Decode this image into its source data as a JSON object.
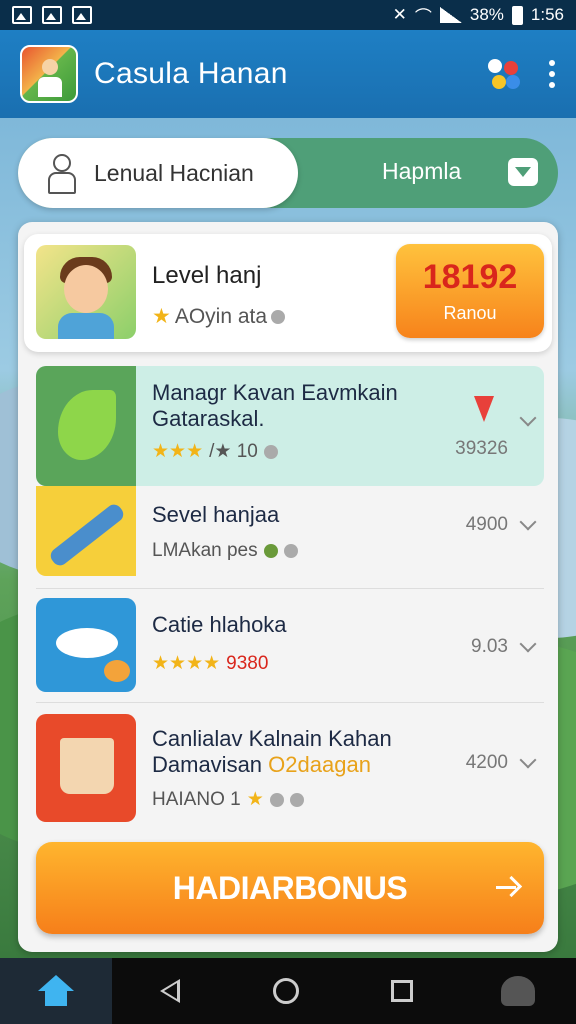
{
  "status_bar": {
    "battery": "38%",
    "time": "1:56"
  },
  "app_bar": {
    "title": "Casula Hanan",
    "icons": [
      "app-logo-icon",
      "cast-icon",
      "more-vert-icon"
    ]
  },
  "tabs": {
    "left_label": "Lenual Hacnian",
    "right_label": "Hapmla"
  },
  "profile": {
    "name": "Level hanj",
    "subtitle": "AOyin ata",
    "score": "18192",
    "score_label": "Ranou"
  },
  "items": [
    {
      "title_line1": "Managr Kavan Eavmkain",
      "title_line2": "Gataraskal.",
      "meta": "/★ 10",
      "value": "39326"
    },
    {
      "title_line1": "Sevel hanjaa",
      "title_line2": "",
      "meta": "LMAkan pes",
      "value": "4900"
    },
    {
      "title_line1": "Catie hlahoka",
      "title_line2": "",
      "meta": "9380",
      "value": "9.03"
    },
    {
      "title_line1": "Canlialav Kalnain Kahan",
      "title_line2": "Damavisan",
      "title_line2_highlight": "O2daagan",
      "meta": "HAIANO 1",
      "value": "4200"
    }
  ],
  "bonus_button": {
    "label": "HADIARBONUS"
  },
  "colors": {
    "accent": "#1e7fc4",
    "orange": "#f7831b",
    "score_red": "#d9261c",
    "highlight_teal": "#cdeee6"
  }
}
